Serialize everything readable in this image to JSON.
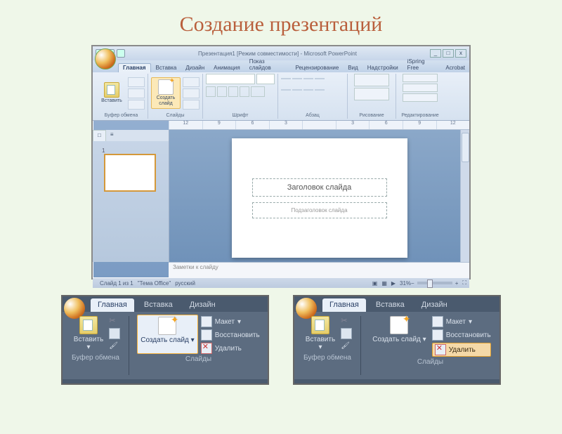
{
  "page": {
    "title": "Создание презентаций"
  },
  "window": {
    "title": "Презентация1 [Режим совместимости] - Microsoft PowerPoint",
    "controls": {
      "min": "_",
      "max": "□",
      "close": "x"
    }
  },
  "tabs": {
    "home": "Главная",
    "insert": "Вставка",
    "design": "Дизайн",
    "anim": "Анимация",
    "show": "Показ слайдов",
    "review": "Рецензирование",
    "view": "Вид",
    "addins": "Надстройки",
    "ispring": "iSpring Free",
    "acrobat": "Acrobat"
  },
  "ribbon": {
    "paste": "Вставить",
    "newslide": "Создать слайд",
    "clipboard": "Буфер обмена",
    "slides": "Слайды",
    "font": "Шрифт",
    "paragraph": "Абзац",
    "drawing": "Рисование",
    "editing": "Редактирование"
  },
  "ruler": [
    "12",
    "9",
    "6",
    "3",
    "",
    "3",
    "6",
    "9",
    "12"
  ],
  "sidepanel": {
    "tab1": "□",
    "tab2": "≡",
    "num": "1"
  },
  "slide": {
    "title_ph": "Заголовок слайда",
    "sub_ph": "Подзаголовок слайда"
  },
  "notes": "Заметки к слайду",
  "status": {
    "slide": "Слайд 1 из 1",
    "theme": "\"Тема Office\"",
    "lang": "русский",
    "zoom": "31%"
  },
  "snip": {
    "tabs": {
      "home": "Главная",
      "insert": "Вставка",
      "design": "Дизайн"
    },
    "paste": "Вставить",
    "newslide": "Создать слайд",
    "layout": "Макет",
    "reset": "Восстановить",
    "delete": "Удалить",
    "clipboard": "Буфер обмена",
    "slides": "Слайды",
    "dd": "▾"
  }
}
